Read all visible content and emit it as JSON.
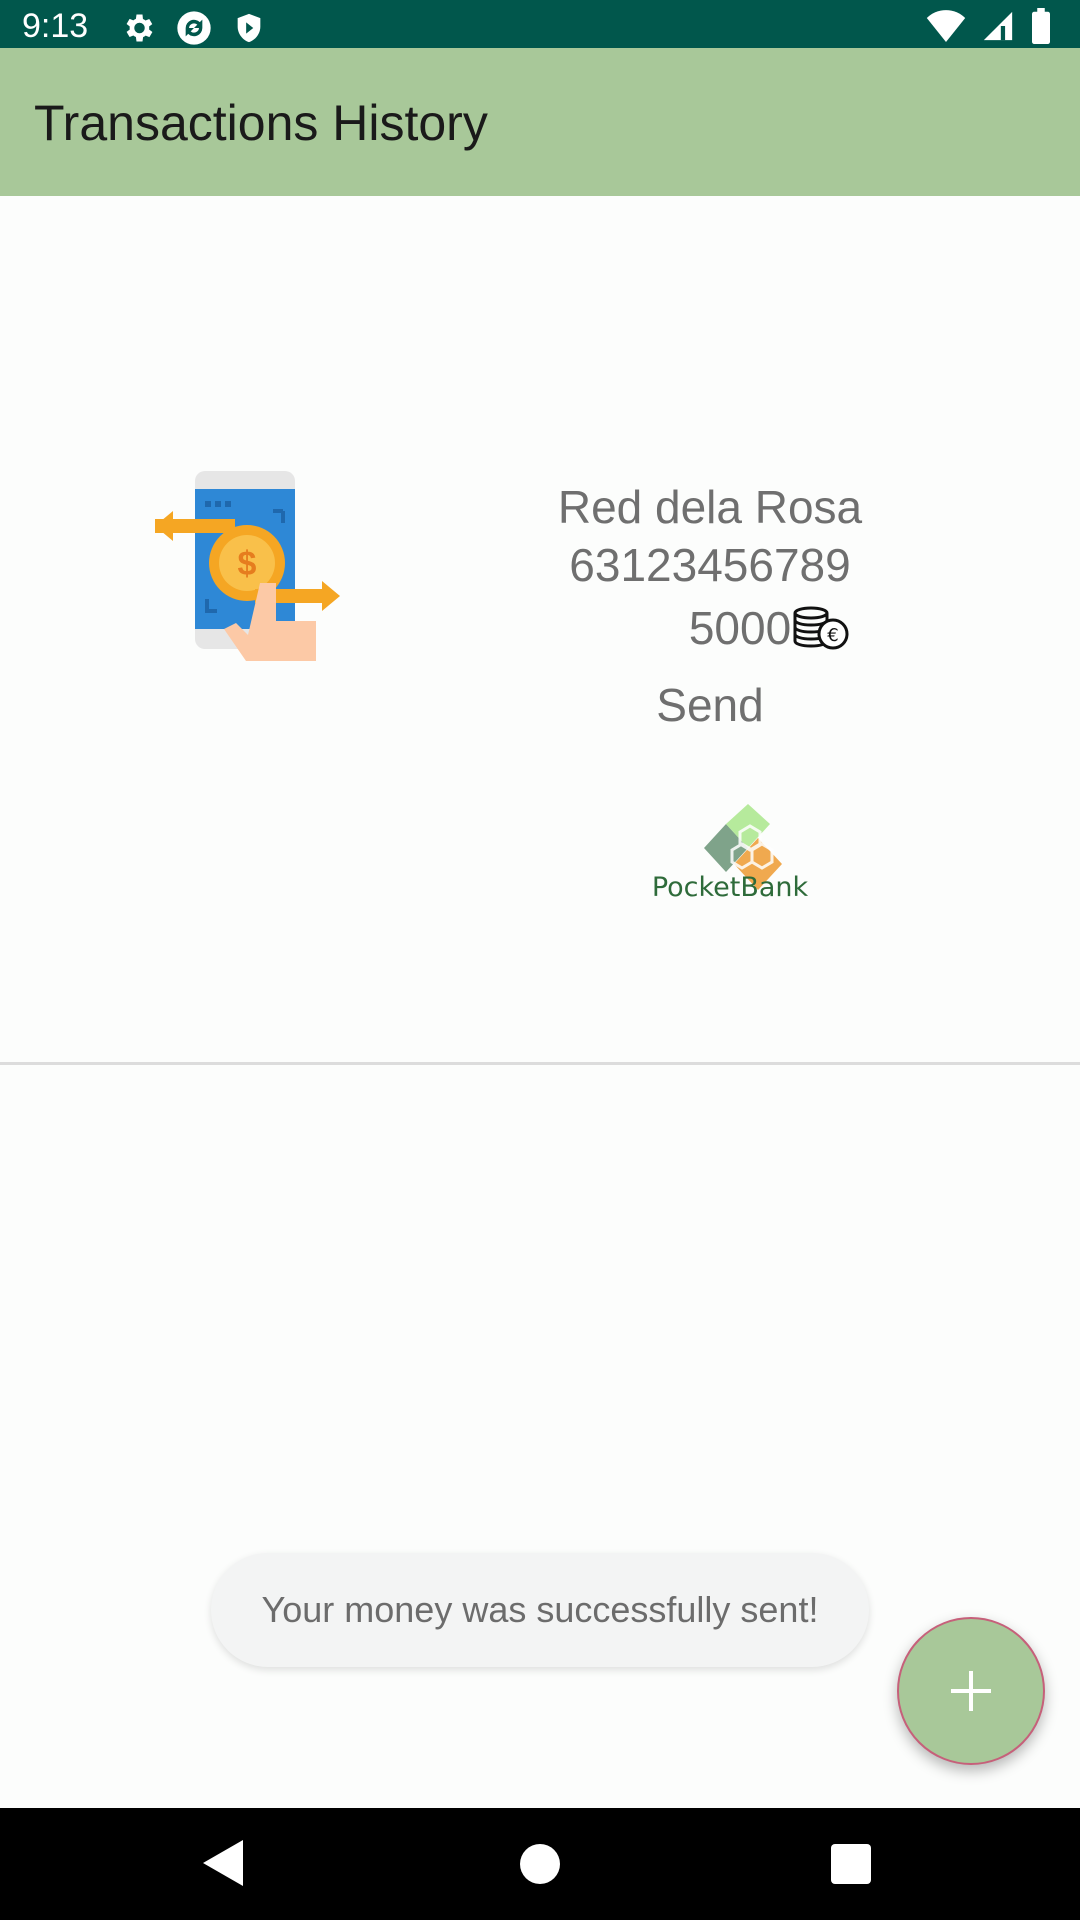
{
  "status_bar": {
    "time": "9:13",
    "icons": [
      "gear-icon",
      "sync-icon",
      "shield-icon",
      "wifi-icon",
      "signal-icon",
      "battery-icon"
    ]
  },
  "app_bar": {
    "title": "Transactions History",
    "color": "#a8c899"
  },
  "transaction": {
    "name": "Red dela Rosa",
    "phone": "63123456789",
    "amount": "5000",
    "type": "Send",
    "illustration": "phone-money-transfer-icon",
    "amount_icon": "euro-coins-icon",
    "logo_text": "PocketBank"
  },
  "toast": {
    "message": "Your money was successfully sent!"
  },
  "fab": {
    "icon": "plus-icon",
    "color": "#a8c899"
  },
  "nav_bar": {
    "icons": [
      "back-icon",
      "home-icon",
      "recents-icon"
    ]
  }
}
